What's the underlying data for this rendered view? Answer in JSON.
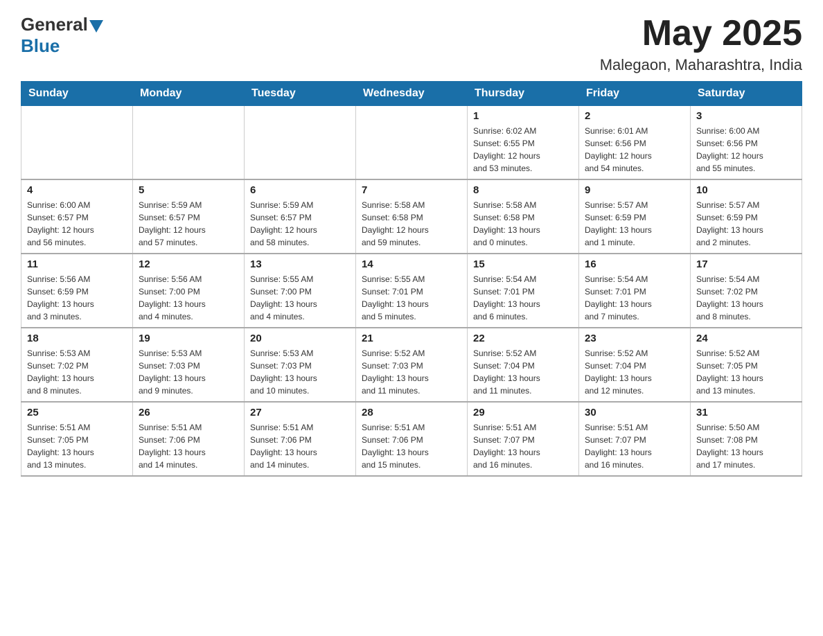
{
  "header": {
    "logo_general": "General",
    "logo_blue": "Blue",
    "month_title": "May 2025",
    "location": "Malegaon, Maharashtra, India"
  },
  "weekdays": [
    "Sunday",
    "Monday",
    "Tuesday",
    "Wednesday",
    "Thursday",
    "Friday",
    "Saturday"
  ],
  "weeks": [
    [
      {
        "day": "",
        "info": ""
      },
      {
        "day": "",
        "info": ""
      },
      {
        "day": "",
        "info": ""
      },
      {
        "day": "",
        "info": ""
      },
      {
        "day": "1",
        "info": "Sunrise: 6:02 AM\nSunset: 6:55 PM\nDaylight: 12 hours\nand 53 minutes."
      },
      {
        "day": "2",
        "info": "Sunrise: 6:01 AM\nSunset: 6:56 PM\nDaylight: 12 hours\nand 54 minutes."
      },
      {
        "day": "3",
        "info": "Sunrise: 6:00 AM\nSunset: 6:56 PM\nDaylight: 12 hours\nand 55 minutes."
      }
    ],
    [
      {
        "day": "4",
        "info": "Sunrise: 6:00 AM\nSunset: 6:57 PM\nDaylight: 12 hours\nand 56 minutes."
      },
      {
        "day": "5",
        "info": "Sunrise: 5:59 AM\nSunset: 6:57 PM\nDaylight: 12 hours\nand 57 minutes."
      },
      {
        "day": "6",
        "info": "Sunrise: 5:59 AM\nSunset: 6:57 PM\nDaylight: 12 hours\nand 58 minutes."
      },
      {
        "day": "7",
        "info": "Sunrise: 5:58 AM\nSunset: 6:58 PM\nDaylight: 12 hours\nand 59 minutes."
      },
      {
        "day": "8",
        "info": "Sunrise: 5:58 AM\nSunset: 6:58 PM\nDaylight: 13 hours\nand 0 minutes."
      },
      {
        "day": "9",
        "info": "Sunrise: 5:57 AM\nSunset: 6:59 PM\nDaylight: 13 hours\nand 1 minute."
      },
      {
        "day": "10",
        "info": "Sunrise: 5:57 AM\nSunset: 6:59 PM\nDaylight: 13 hours\nand 2 minutes."
      }
    ],
    [
      {
        "day": "11",
        "info": "Sunrise: 5:56 AM\nSunset: 6:59 PM\nDaylight: 13 hours\nand 3 minutes."
      },
      {
        "day": "12",
        "info": "Sunrise: 5:56 AM\nSunset: 7:00 PM\nDaylight: 13 hours\nand 4 minutes."
      },
      {
        "day": "13",
        "info": "Sunrise: 5:55 AM\nSunset: 7:00 PM\nDaylight: 13 hours\nand 4 minutes."
      },
      {
        "day": "14",
        "info": "Sunrise: 5:55 AM\nSunset: 7:01 PM\nDaylight: 13 hours\nand 5 minutes."
      },
      {
        "day": "15",
        "info": "Sunrise: 5:54 AM\nSunset: 7:01 PM\nDaylight: 13 hours\nand 6 minutes."
      },
      {
        "day": "16",
        "info": "Sunrise: 5:54 AM\nSunset: 7:01 PM\nDaylight: 13 hours\nand 7 minutes."
      },
      {
        "day": "17",
        "info": "Sunrise: 5:54 AM\nSunset: 7:02 PM\nDaylight: 13 hours\nand 8 minutes."
      }
    ],
    [
      {
        "day": "18",
        "info": "Sunrise: 5:53 AM\nSunset: 7:02 PM\nDaylight: 13 hours\nand 8 minutes."
      },
      {
        "day": "19",
        "info": "Sunrise: 5:53 AM\nSunset: 7:03 PM\nDaylight: 13 hours\nand 9 minutes."
      },
      {
        "day": "20",
        "info": "Sunrise: 5:53 AM\nSunset: 7:03 PM\nDaylight: 13 hours\nand 10 minutes."
      },
      {
        "day": "21",
        "info": "Sunrise: 5:52 AM\nSunset: 7:03 PM\nDaylight: 13 hours\nand 11 minutes."
      },
      {
        "day": "22",
        "info": "Sunrise: 5:52 AM\nSunset: 7:04 PM\nDaylight: 13 hours\nand 11 minutes."
      },
      {
        "day": "23",
        "info": "Sunrise: 5:52 AM\nSunset: 7:04 PM\nDaylight: 13 hours\nand 12 minutes."
      },
      {
        "day": "24",
        "info": "Sunrise: 5:52 AM\nSunset: 7:05 PM\nDaylight: 13 hours\nand 13 minutes."
      }
    ],
    [
      {
        "day": "25",
        "info": "Sunrise: 5:51 AM\nSunset: 7:05 PM\nDaylight: 13 hours\nand 13 minutes."
      },
      {
        "day": "26",
        "info": "Sunrise: 5:51 AM\nSunset: 7:06 PM\nDaylight: 13 hours\nand 14 minutes."
      },
      {
        "day": "27",
        "info": "Sunrise: 5:51 AM\nSunset: 7:06 PM\nDaylight: 13 hours\nand 14 minutes."
      },
      {
        "day": "28",
        "info": "Sunrise: 5:51 AM\nSunset: 7:06 PM\nDaylight: 13 hours\nand 15 minutes."
      },
      {
        "day": "29",
        "info": "Sunrise: 5:51 AM\nSunset: 7:07 PM\nDaylight: 13 hours\nand 16 minutes."
      },
      {
        "day": "30",
        "info": "Sunrise: 5:51 AM\nSunset: 7:07 PM\nDaylight: 13 hours\nand 16 minutes."
      },
      {
        "day": "31",
        "info": "Sunrise: 5:50 AM\nSunset: 7:08 PM\nDaylight: 13 hours\nand 17 minutes."
      }
    ]
  ]
}
